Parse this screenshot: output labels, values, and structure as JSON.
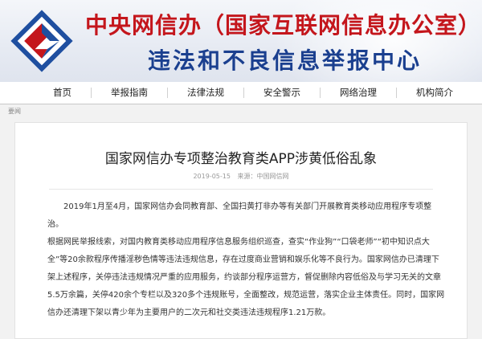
{
  "header": {
    "title_line1": "中央网信办（国家互联网信息办公室）",
    "title_line2": "违法和不良信息举报中心",
    "brand_red": "#c4161c",
    "brand_blue": "#1a3f8f",
    "logo_icon": "cac-logo-icon"
  },
  "nav": {
    "items": [
      "首页",
      "举报指南",
      "法律法规",
      "安全警示",
      "网络治理",
      "机构简介"
    ]
  },
  "breadcrumb": "要闻",
  "article": {
    "title": "国家网信办专项整治教育类APP涉黄低俗乱象",
    "date": "2019-05-15",
    "source": "来源：中国网信网",
    "para1": "2019年1月至4月，国家网信办会同教育部、全国扫黄打非办等有关部门开展教育类移动应用程序专项整治。",
    "para2": "根据网民举报线索，对国内教育类移动应用程序信息服务组织巡查，查实“作业狗”“口袋老师”“初中知识点大全”等20余款程序传播淫秽色情等违法违规信息，存在过度商业营销和娱乐化等不良行为。国家网信办已清理下架上述程序，关停违法违规情况严重的应用服务，约谈部分程序运营方，督促删除内容低俗及与学习无关的文章5.5万余篇，关停420余个专栏以及320多个违规账号，全面整改，规范运营，落实企业主体责任。同时，国家网信办还清理下架以青少年为主要用户的二次元和社交类违法违规程序1.21万款。"
  }
}
